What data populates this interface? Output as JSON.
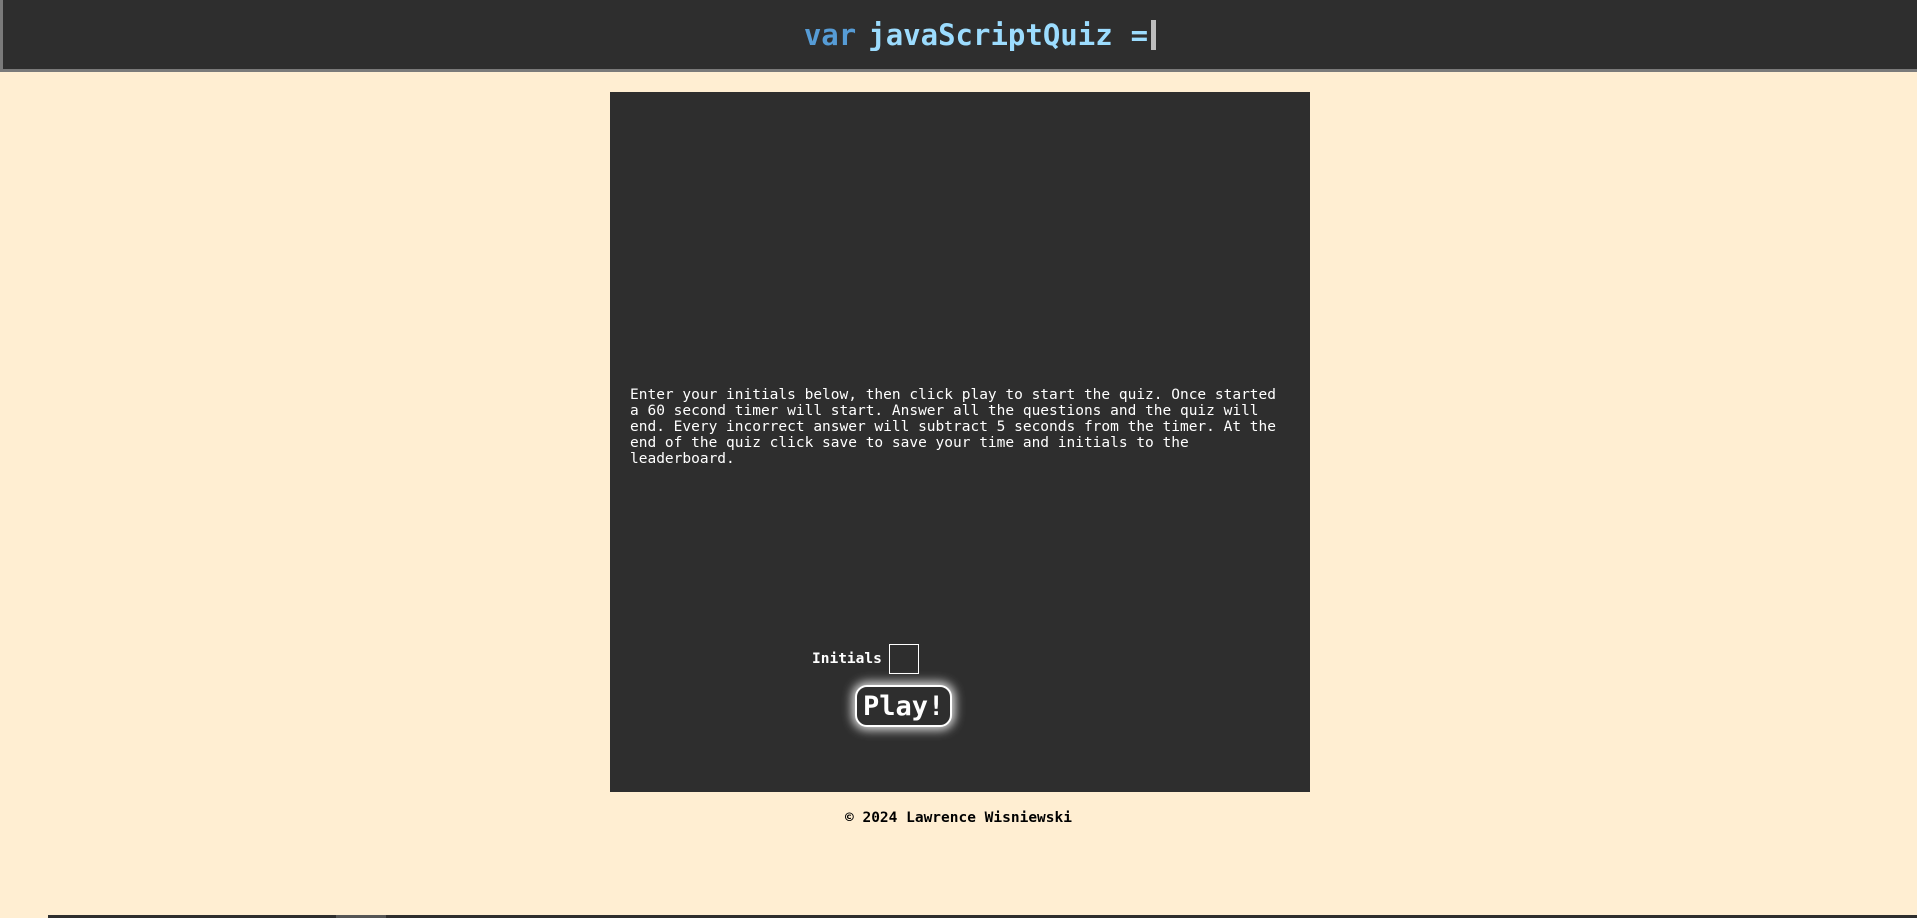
{
  "header": {
    "keyword": "var",
    "identifier": "javaScriptQuiz",
    "operator": "="
  },
  "quiz": {
    "instructions": "Enter your initials below, then click play to start the quiz. Once started a 60 second timer will start. Answer all the questions and the quiz will end. Every incorrect answer will subtract 5 seconds from the timer. At the end of the quiz click save to save your time and initials to the leaderboard.",
    "initials_label": "Initials",
    "initials_value": "",
    "play_label": "Play!"
  },
  "footer": {
    "copyright": "© 2024 Lawrence Wisniewski"
  },
  "colors": {
    "page_background": "#ffeed2",
    "panel_background": "#2e2e2e",
    "keyword": "#569cd6",
    "identifier": "#9cdcfe"
  }
}
